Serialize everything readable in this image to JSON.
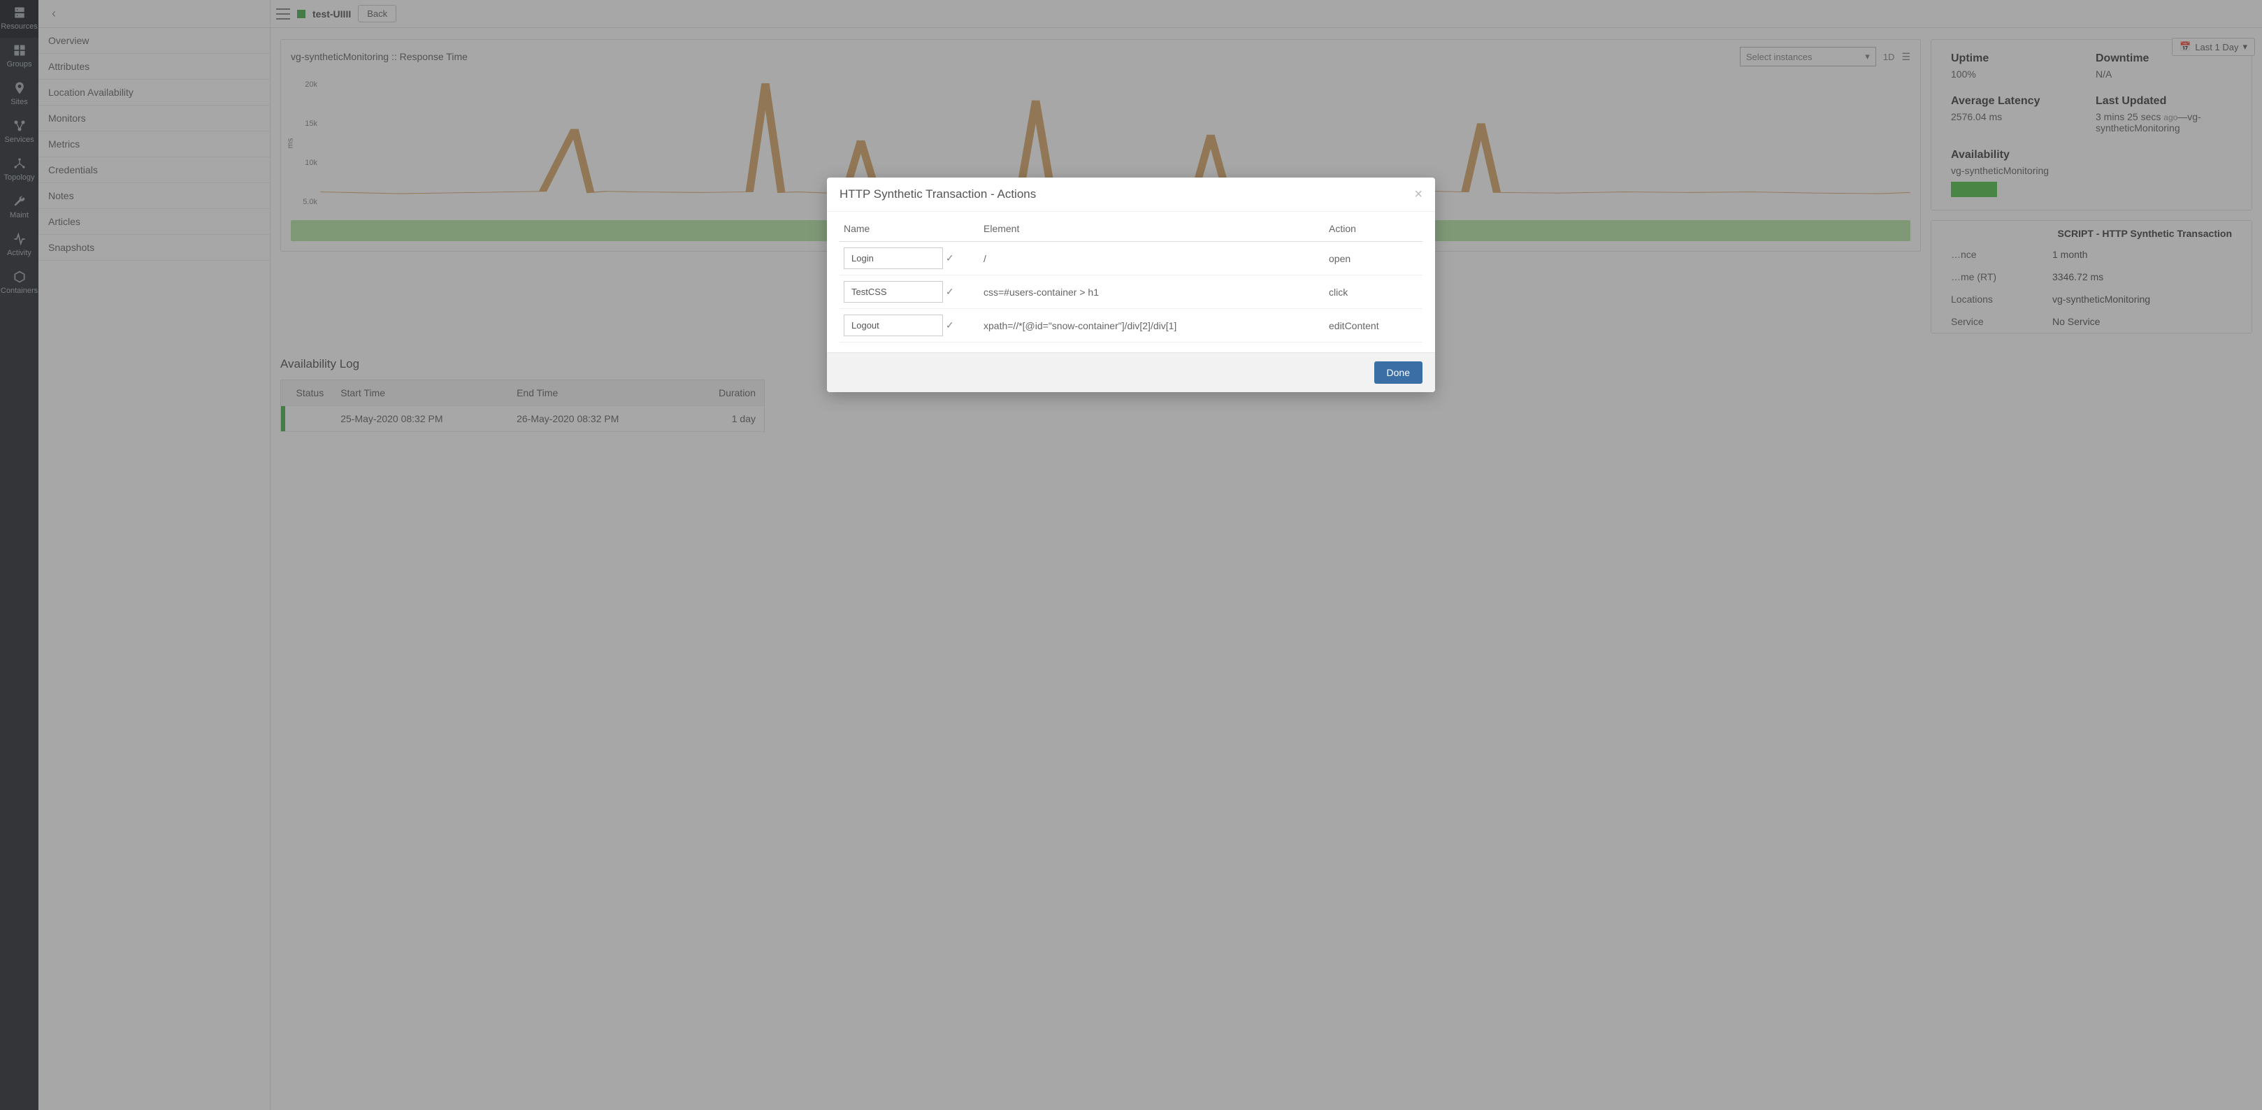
{
  "rail": [
    {
      "name": "resources",
      "label": "Resources"
    },
    {
      "name": "groups",
      "label": "Groups"
    },
    {
      "name": "sites",
      "label": "Sites"
    },
    {
      "name": "services",
      "label": "Services"
    },
    {
      "name": "topology",
      "label": "Topology"
    },
    {
      "name": "maint",
      "label": "Maint"
    },
    {
      "name": "activity",
      "label": "Activity"
    },
    {
      "name": "containers",
      "label": "Containers"
    }
  ],
  "sidebar": {
    "items": [
      "Overview",
      "Attributes",
      "Location Availability",
      "Monitors",
      "Metrics",
      "Credentials",
      "Notes",
      "Articles",
      "Snapshots"
    ]
  },
  "header": {
    "title": "test-UIIII",
    "back": "Back",
    "time_picker": "Last 1 Day"
  },
  "chart_data": {
    "type": "line",
    "title": "vg-syntheticMonitoring :: Response Time",
    "select_placeholder": "Select instances",
    "range_label": "1D",
    "ylabel": "ms",
    "y_ticks": [
      "20k",
      "15k",
      "10k",
      "5.0k"
    ],
    "ylim": [
      0,
      22000
    ],
    "series": [
      {
        "name": "response_time",
        "x": [
          0,
          5,
          10,
          14,
          16,
          17,
          18,
          20,
          24,
          27,
          28,
          29,
          30,
          33,
          34,
          35,
          36,
          40,
          44,
          45,
          46,
          48,
          52,
          55,
          56,
          57,
          58,
          62,
          66,
          70,
          72,
          73,
          74,
          78,
          82,
          86,
          90,
          94,
          98,
          100
        ],
        "y": [
          2500,
          2200,
          2400,
          2600,
          13500,
          2400,
          2600,
          2500,
          2400,
          2500,
          21500,
          2400,
          2500,
          2200,
          11500,
          2300,
          2500,
          2600,
          2400,
          18500,
          2300,
          2500,
          2400,
          2600,
          12500,
          2500,
          2400,
          2500,
          2300,
          2600,
          2500,
          14500,
          2400,
          2300,
          2500,
          2400,
          2500,
          2300,
          2200,
          2400
        ]
      }
    ]
  },
  "stats": {
    "uptime_label": "Uptime",
    "uptime": "100%",
    "downtime_label": "Downtime",
    "downtime": "N/A",
    "latency_label": "Average Latency",
    "latency": "2576.04 ms",
    "updated_label": "Last Updated",
    "updated_time": "3 mins 25 secs",
    "updated_ago": "ago",
    "updated_src": "—vg-syntheticMonitoring",
    "avail_label": "Availability",
    "avail_src": "vg-syntheticMonitoring"
  },
  "details": {
    "header": "SCRIPT - HTTP Synthetic Transaction",
    "rows": [
      {
        "k": "…nce",
        "v": "1 month"
      },
      {
        "k": "…me (RT)",
        "v": "3346.72 ms"
      },
      {
        "k": "Locations",
        "v": "vg-syntheticMonitoring"
      },
      {
        "k": "Service",
        "v": "No Service"
      }
    ]
  },
  "avail_log": {
    "title": "Availability Log",
    "cols": {
      "status": "Status",
      "start": "Start Time",
      "end": "End Time",
      "dur": "Duration"
    },
    "rows": [
      {
        "start": "25-May-2020 08:32 PM",
        "end": "26-May-2020 08:32 PM",
        "dur": "1 day"
      }
    ]
  },
  "modal": {
    "title": "HTTP Synthetic Transaction - Actions",
    "done": "Done",
    "cols": {
      "name": "Name",
      "element": "Element",
      "action": "Action"
    },
    "rows": [
      {
        "name": "Login",
        "element": "/",
        "action": "open"
      },
      {
        "name": "TestCSS",
        "element": "css=#users-container > h1",
        "action": "click"
      },
      {
        "name": "Logout",
        "element": "xpath=//*[@id=\"snow-container\"]/div[2]/div[1]",
        "action": "editContent"
      }
    ]
  }
}
